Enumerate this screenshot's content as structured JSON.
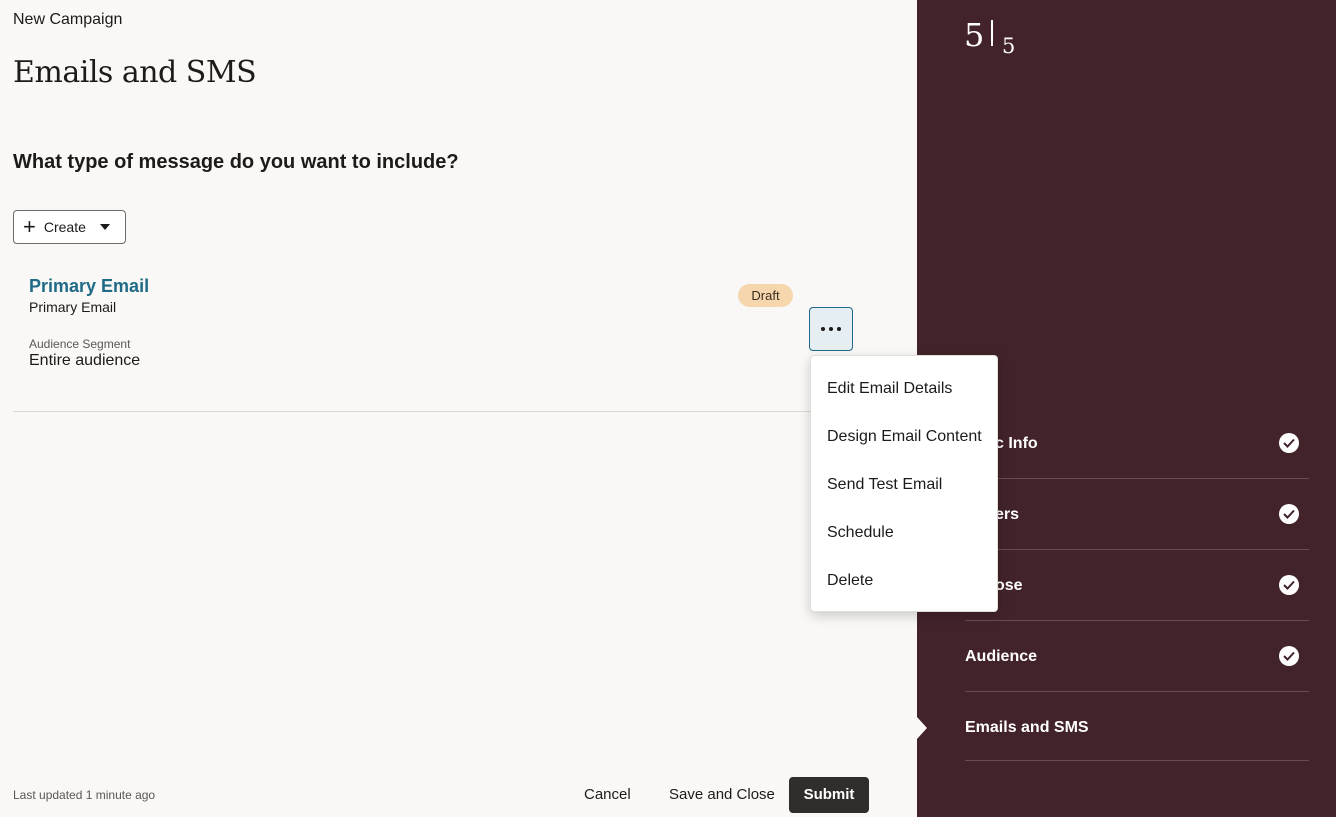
{
  "header": {
    "breadcrumb": "New Campaign",
    "title": "Emails and SMS"
  },
  "main": {
    "question": "What type of message do you want to include?",
    "create_label": "Create",
    "card": {
      "title": "Primary Email",
      "subtitle": "Primary Email",
      "segment_label": "Audience Segment",
      "segment_value": "Entire audience",
      "status": "Draft"
    }
  },
  "menu": {
    "items": [
      "Edit Email Details",
      "Design Email Content",
      "Send Test Email",
      "Schedule",
      "Delete"
    ]
  },
  "footer": {
    "last_updated": "Last updated 1 minute ago",
    "cancel": "Cancel",
    "save_close": "Save and Close",
    "submit": "Submit"
  },
  "sidebar": {
    "current_step": "5",
    "total_steps": "5",
    "steps": [
      {
        "label": "Basic Info",
        "visible": "c Info",
        "done": true
      },
      {
        "label": "Offers",
        "visible": "ers",
        "done": true
      },
      {
        "label": "Purpose",
        "visible": "ose",
        "done": true
      },
      {
        "label": "Audience",
        "done": true
      },
      {
        "label": "Emails and SMS",
        "done": false,
        "current": true
      }
    ]
  },
  "colors": {
    "sidebar_bg": "#42232a",
    "link": "#1f6a86",
    "badge_bg": "#f6d7ad",
    "submit_bg": "#312d2a"
  }
}
